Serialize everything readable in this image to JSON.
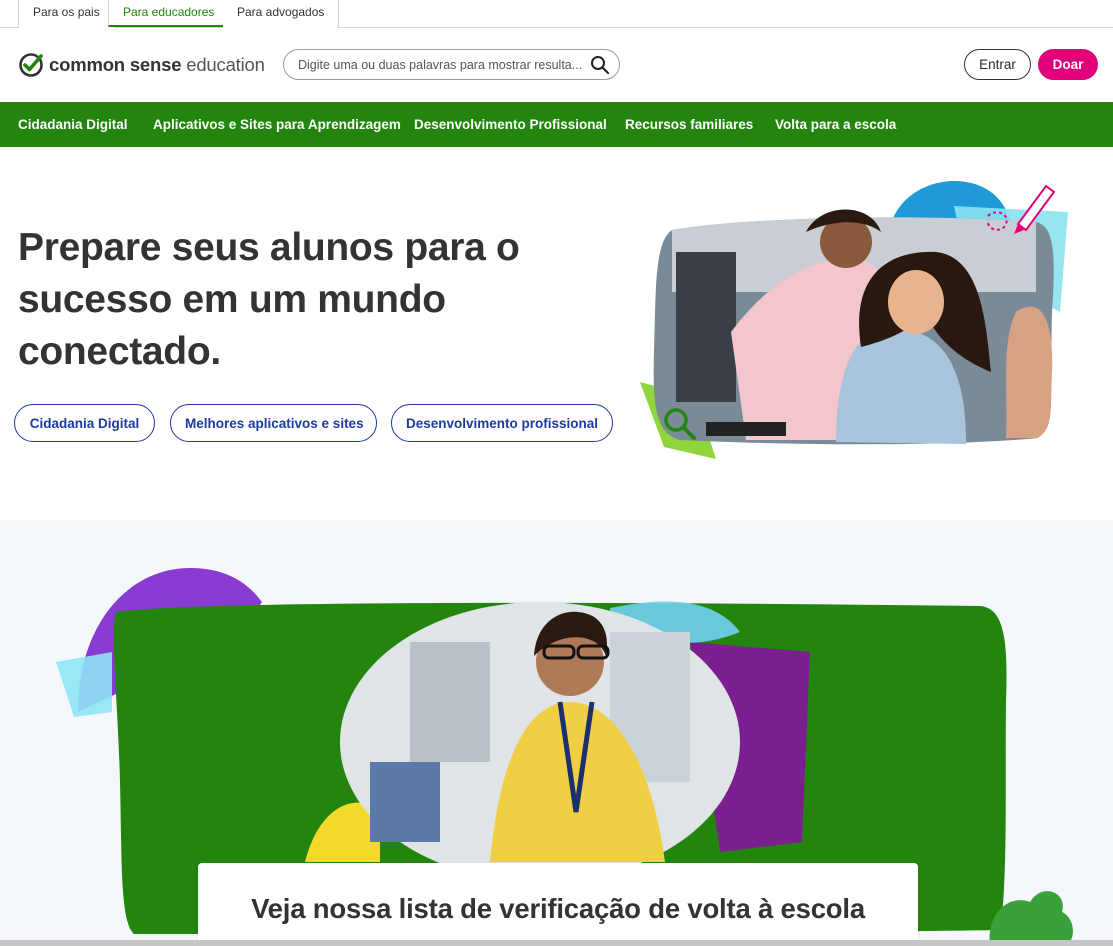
{
  "audience_tabs": [
    {
      "label": "Para os pais"
    },
    {
      "label": "Para educadores"
    },
    {
      "label": "Para advogados"
    }
  ],
  "header": {
    "logo_bold": "common sense",
    "logo_light": "education",
    "search_placeholder": "Digite uma ou duas palavras para mostrar resulta...",
    "login_label": "Entrar",
    "donate_label": "Doar"
  },
  "nav": {
    "items": [
      {
        "label": "Cidadania Digital"
      },
      {
        "label": "Aplicativos e Sites para Aprendizagem"
      },
      {
        "label": "Desenvolvimento Profissional"
      },
      {
        "label": "Recursos familiares"
      },
      {
        "label": "Volta para a escola"
      }
    ]
  },
  "hero": {
    "title": "Prepare seus alunos para o sucesso em um mundo conectado.",
    "buttons": [
      {
        "label": "Cidadania Digital"
      },
      {
        "label": "Melhores aplicativos e sites"
      },
      {
        "label": "Desenvolvimento profissional"
      }
    ]
  },
  "feature": {
    "card_title": "Veja nossa lista de verificação de volta à escola"
  },
  "colors": {
    "brand_green": "#23850d",
    "donate_pink": "#e2007a",
    "pill_blue": "#1c3ba1",
    "text_dark": "#333333",
    "section_bg": "#f4f7fb"
  },
  "icons": {
    "logo": "check-circle-icon",
    "search": "search-icon",
    "pencil": "pencil-icon",
    "magnifier": "magnifier-icon"
  }
}
